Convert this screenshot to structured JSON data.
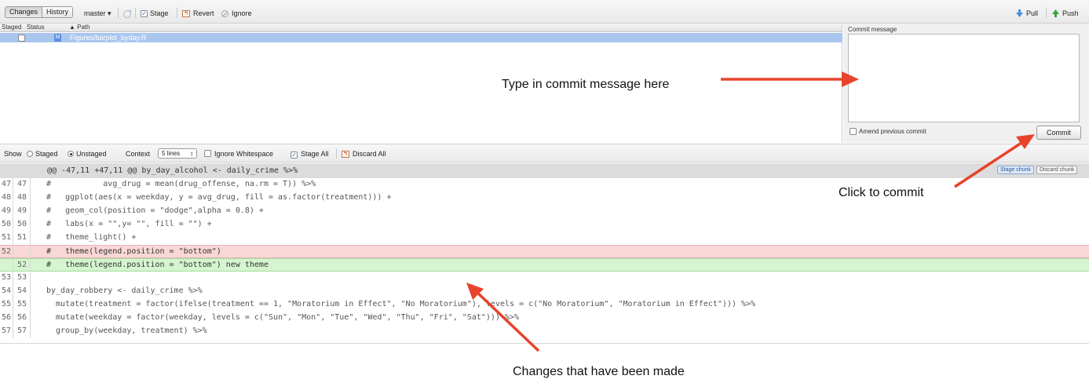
{
  "toolbar": {
    "tabs": [
      "Changes",
      "History"
    ],
    "branch": "master ▾",
    "stage": "Stage",
    "revert": "Revert",
    "ignore": "Ignore",
    "pull": "Pull",
    "push": "Push"
  },
  "files": {
    "headers": {
      "staged": "Staged",
      "status": "Status",
      "path": "▲ Path"
    },
    "rows": [
      {
        "status": "M",
        "path": "Figures/barplot_byday.R",
        "staged": false
      }
    ]
  },
  "commit": {
    "label": "Commit message",
    "message": "",
    "amend": "Amend previous commit",
    "button": "Commit"
  },
  "options": {
    "show": "Show",
    "staged": "Staged",
    "unstaged": "Unstaged",
    "context": "Context",
    "context_value": "5 lines",
    "ignore_ws": "Ignore Whitespace",
    "stage_all": "Stage All",
    "discard_all": "Discard All"
  },
  "diff": {
    "hunk_header": "@@ -47,11 +47,11 @@ by_day_alcohol <- daily_crime %>%",
    "stage_chunk": "Stage chunk",
    "discard_chunk": "Discard chunk",
    "lines": [
      {
        "old": "47",
        "new": "47",
        "type": "ctx",
        "text": "#           avg_drug = mean(drug_offense, na.rm = T)) %>%"
      },
      {
        "old": "48",
        "new": "48",
        "type": "ctx",
        "text": "#   ggplot(aes(x = weekday, y = avg_drug, fill = as.factor(treatment))) +"
      },
      {
        "old": "49",
        "new": "49",
        "type": "ctx",
        "text": "#   geom_col(position = \"dodge\",alpha = 0.8) +"
      },
      {
        "old": "50",
        "new": "50",
        "type": "ctx",
        "text": "#   labs(x = \"\",y= \"\", fill = \"\") +"
      },
      {
        "old": "51",
        "new": "51",
        "type": "ctx",
        "text": "#   theme_light() +"
      },
      {
        "old": "52",
        "new": "",
        "type": "del",
        "text": "#   theme(legend.position = \"bottom\")"
      },
      {
        "old": "",
        "new": "52",
        "type": "add",
        "text": "#   theme(legend.position = \"bottom\") new theme"
      },
      {
        "old": "53",
        "new": "53",
        "type": "ctx",
        "text": ""
      },
      {
        "old": "54",
        "new": "54",
        "type": "ctx",
        "text": "by_day_robbery <- daily_crime %>%"
      },
      {
        "old": "55",
        "new": "55",
        "type": "ctx",
        "text": "  mutate(treatment = factor(ifelse(treatment == 1, \"Moratorium in Effect\", \"No Moratorium\"), levels = c(\"No Moratorium\", \"Moratorium in Effect\"))) %>%"
      },
      {
        "old": "56",
        "new": "56",
        "type": "ctx",
        "text": "  mutate(weekday = factor(weekday, levels = c(\"Sun\", \"Mon\", \"Tue\", \"Wed\", \"Thu\", \"Fri\", \"Sat\"))) %>%"
      },
      {
        "old": "57",
        "new": "57",
        "type": "ctx",
        "text": "  group_by(weekday, treatment) %>%"
      }
    ]
  },
  "annotations": {
    "commit_message": "Type in commit message here",
    "click_commit": "Click to commit",
    "changes": "Changes that have been made"
  },
  "colors": {
    "arrow": "#e8432c",
    "selected_row": "#a9c6ee",
    "deleted": "#fad7d7",
    "added": "#d4f5cf"
  },
  "icons": [
    "refresh-icon",
    "stage-check-icon",
    "revert-icon",
    "ignore-icon",
    "pull-arrow-icon",
    "push-arrow-icon"
  ]
}
